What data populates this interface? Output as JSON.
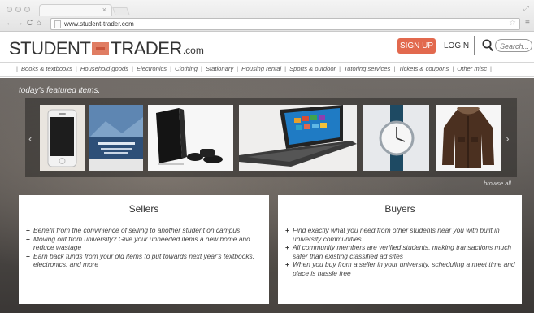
{
  "browser": {
    "url": "www.student-trader.com",
    "tab_close": "×",
    "star": "☆",
    "menu": "≡",
    "nav": {
      "back": "←",
      "forward": "→",
      "reload": "C",
      "home": "⌂"
    }
  },
  "site": {
    "logo_left": "STUDENT",
    "logo_right": "TRADER",
    "logo_suffix": ".com",
    "signup_label": "SIGN UP",
    "login_label": "LOGIN",
    "search_placeholder": "Search..."
  },
  "categories": [
    "Books & textbooks",
    "Household goods",
    "Electronics",
    "Clothing",
    "Stationary",
    "Housing rental",
    "Sports & outdoor",
    "Tutoring services",
    "Tickets & coupons",
    "Other misc"
  ],
  "featured": {
    "caption": "today's featured items.",
    "browse_label": "browse all",
    "items": [
      "iphone-image",
      "textbook-image",
      "game-console-image",
      "laptop-image",
      "wristwatch-image",
      "jacket-image"
    ]
  },
  "sellers": {
    "title": "Sellers",
    "points": [
      "Benefit from the convinience of selling to another student on campus",
      "Moving out from university? Give your unneeded items a new home and reduce wastage",
      "Earn back funds from your old items to put towards next year's textbooks, electronics, and more"
    ]
  },
  "buyers": {
    "title": "Buyers",
    "points": [
      "Find exactly what you need from other students near you with built in university communities",
      "All community members are verified students, making transactions much safer than existing classified ad sites",
      "When you buy from a seller in your university, scheduling a meet time and place is hassle free"
    ]
  },
  "colors": {
    "accent": "#e2694e",
    "logo_box": "#e07d63",
    "hero_dark": "#4e4a47"
  }
}
